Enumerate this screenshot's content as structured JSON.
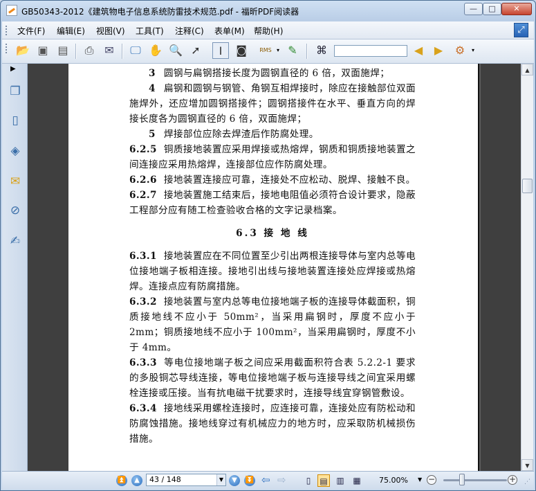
{
  "window": {
    "title": "GB50343-2012《建筑物电子信息系统防雷技术规范.pdf - 福昕PDF阅读器",
    "minimize": "—",
    "maximize": "□",
    "close": "✕"
  },
  "menu": [
    {
      "label": "文件(F)"
    },
    {
      "label": "编辑(E)"
    },
    {
      "label": "视图(V)"
    },
    {
      "label": "工具(T)"
    },
    {
      "label": "注释(C)"
    },
    {
      "label": "表单(M)"
    },
    {
      "label": "帮助(H)"
    }
  ],
  "toolbar": {
    "icons": [
      "open-folder-icon",
      "save-icon",
      "save-as-icon",
      "print-icon",
      "email-icon",
      "fullscreen-icon",
      "hand-tool-icon",
      "zoom-tool-icon",
      "select-arrow-icon",
      "text-select-icon",
      "snapshot-icon",
      "rms-icon",
      "highlight-icon",
      "binoculars-icon",
      "find-previous-icon",
      "find-next-icon",
      "search-options-icon"
    ],
    "rms_label": "RMS",
    "search_value": ""
  },
  "sidebar": {
    "icons": [
      "pages-icon",
      "bookmarks-icon",
      "layers-icon",
      "comments-icon",
      "attachments-icon",
      "signatures-icon"
    ]
  },
  "document": {
    "paragraphs": [
      {
        "type": "sub",
        "num": "3",
        "text": "圆钢与扁钢搭接长度为圆钢直径的 6 倍，双面施焊；"
      },
      {
        "type": "sub",
        "num": "4",
        "text": "扁钢和圆钢与钢管、角钢互相焊接时，除应在接触部位双面施焊外，还应增加圆钢搭接件；圆钢搭接件在水平、垂直方向的焊接长度各为圆钢直径的 6 倍，双面施焊；"
      },
      {
        "type": "sub",
        "num": "5",
        "text": "焊接部位应除去焊渣后作防腐处理。"
      },
      {
        "type": "clause",
        "num": "6.2.5",
        "text": "铜质接地装置应采用焊接或热熔焊，钢质和铜质接地装置之间连接应采用热熔焊，连接部位应作防腐处理。"
      },
      {
        "type": "clause",
        "num": "6.2.6",
        "text": "接地装置连接应可靠，连接处不应松动、脱焊、接触不良。"
      },
      {
        "type": "clause",
        "num": "6.2.7",
        "text": "接地装置施工结束后，接地电阻值必须符合设计要求，隐蔽工程部分应有随工检查验收合格的文字记录档案。"
      },
      {
        "type": "heading",
        "num": "",
        "text": "6.3 接 地 线"
      },
      {
        "type": "clause",
        "num": "6.3.1",
        "text": "接地装置应在不同位置至少引出两根连接导体与室内总等电位接地端子板相连接。接地引出线与接地装置连接处应焊接或热熔焊。连接点应有防腐措施。"
      },
      {
        "type": "clause",
        "num": "6.3.2",
        "text": "接地装置与室内总等电位接地端子板的连接导体截面积，铜质接地线不应小于 50mm²，当采用扁钢时，厚度不应小于 2mm；铜质接地线不应小于 100mm²，当采用扁钢时，厚度不小于 4mm。"
      },
      {
        "type": "clause",
        "num": "6.3.3",
        "text": "等电位接地端子板之间应采用截面积符合表 5.2.2-1 要求的多股铜芯导线连接，等电位接地端子板与连接导线之间宜采用螺栓连接或压接。当有抗电磁干扰要求时，连接导线宜穿钢管敷设。"
      },
      {
        "type": "clause",
        "num": "6.3.4",
        "text": "接地线采用螺栓连接时，应连接可靠，连接处应有防松动和防腐蚀措施。接地线穿过有机械应力的地方时，应采取防机械损伤措施。"
      }
    ]
  },
  "statusbar": {
    "page_display": "43 / 148",
    "zoom": "75.00%",
    "zoom_out": "−",
    "zoom_in": "+"
  }
}
